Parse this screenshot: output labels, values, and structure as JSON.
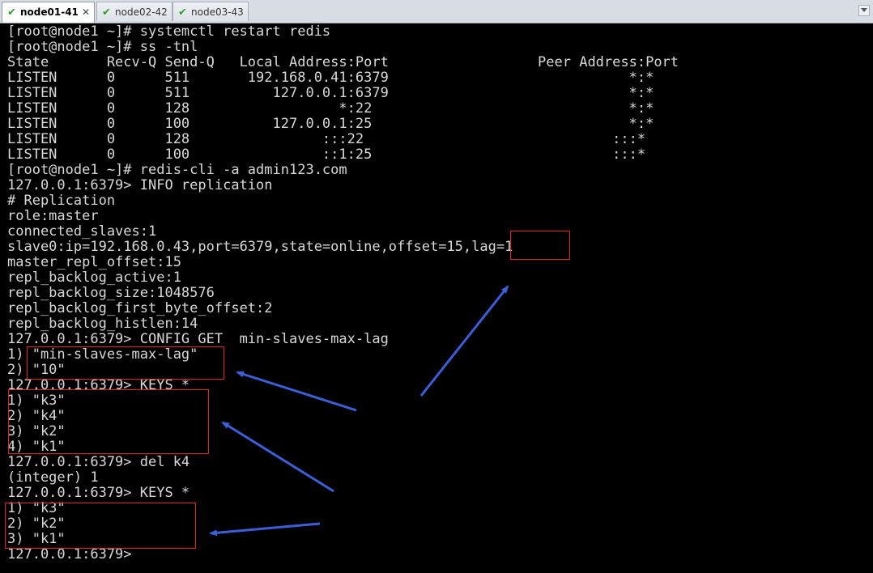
{
  "tabs": [
    {
      "label": "node01-41",
      "active": true
    },
    {
      "label": "node02-42",
      "active": false
    },
    {
      "label": "node03-43",
      "active": false
    }
  ],
  "terminal": {
    "lines": [
      "[root@node1 ~]# systemctl restart redis",
      "[root@node1 ~]# ss -tnl",
      "State       Recv-Q Send-Q   Local Address:Port                  Peer Address:Port",
      "LISTEN      0      511       192.168.0.41:6379                             *:*",
      "LISTEN      0      511          127.0.0.1:6379                             *:*",
      "LISTEN      0      128                  *:22                               *:*",
      "LISTEN      0      100          127.0.0.1:25                               *:*",
      "LISTEN      0      128                :::22                              :::*",
      "LISTEN      0      100                ::1:25                             :::*",
      "[root@node1 ~]# redis-cli -a admin123.com",
      "127.0.0.1:6379> INFO replication",
      "# Replication",
      "role:master",
      "connected_slaves:1",
      "slave0:ip=192.168.0.43,port=6379,state=online,offset=15,lag=1",
      "master_repl_offset:15",
      "repl_backlog_active:1",
      "repl_backlog_size:1048576",
      "repl_backlog_first_byte_offset:2",
      "repl_backlog_histlen:14",
      "127.0.0.1:6379> CONFIG GET  min-slaves-max-lag",
      "1) \"min-slaves-max-lag\"",
      "2) \"10\"",
      "127.0.0.1:6379> KEYS *",
      "1) \"k3\"",
      "2) \"k4\"",
      "3) \"k2\"",
      "4) \"k1\"",
      "127.0.0.1:6379> del k4",
      "(integer) 1",
      "127.0.0.1:6379> KEYS *",
      "1) \"k3\"",
      "2) \"k2\"",
      "3) \"k1\"",
      "127.0.0.1:6379> "
    ]
  },
  "colors": {
    "terminal_bg": "#000000",
    "terminal_text": "#d8d8d8",
    "highlight_box": "#e0241e",
    "annotation_arrow": "#3b5fd9",
    "tab_check": "#2e9e2e"
  },
  "icons": {
    "tab_status": "check-icon",
    "tab_close": "close-icon",
    "tab_overflow": "dropdown-arrow-icon"
  }
}
